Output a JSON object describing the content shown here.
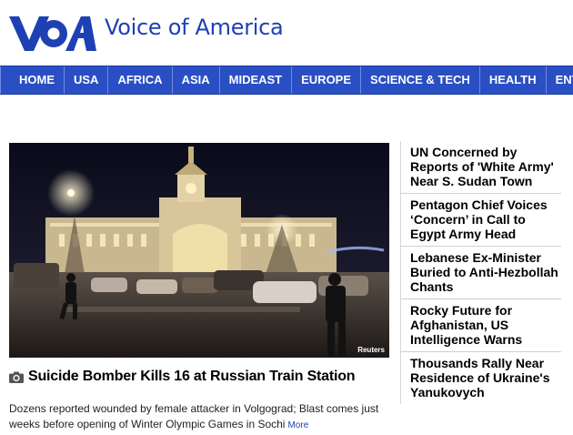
{
  "brand": {
    "name": "Voice of America",
    "color": "#1e40b5"
  },
  "nav": {
    "items": [
      "HOME",
      "USA",
      "AFRICA",
      "ASIA",
      "MIDEAST",
      "EUROPE",
      "SCIENCE & TECH",
      "HEALTH",
      "ENTERT"
    ],
    "background": "#2a4fc4"
  },
  "lead": {
    "photo_credit": "Reuters",
    "camera_icon": "camera-icon",
    "headline": "Suicide Bomber Kills 16 at Russian Train Station",
    "summary": "Dozens reported wounded by female attacker in Volgograd; Blast comes just weeks before opening of Winter Olympic Games in Sochi",
    "more_label": "More"
  },
  "sidebar": {
    "stories": [
      "UN Concerned by Reports of 'White Army' Near S. Sudan Town",
      "Pentagon Chief Voices ‘Concern’ in Call to Egypt Army Head",
      "Lebanese Ex-Minister Buried to Anti-Hezbollah Chants",
      "Rocky Future for Afghanistan, US Intelligence Warns",
      "Thousands Rally Near Residence of Ukraine's Yanukovych"
    ]
  }
}
